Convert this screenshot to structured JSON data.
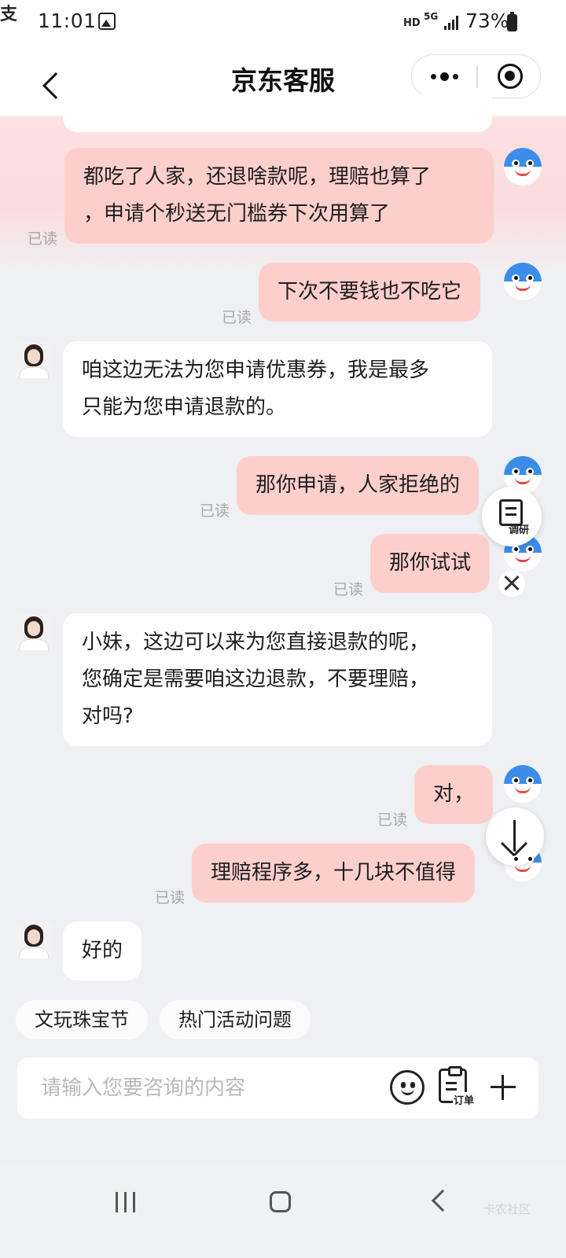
{
  "status_bar": {
    "time": "11:01",
    "network_hd": "HD",
    "network_gen": "5G",
    "battery": "73%"
  },
  "header": {
    "title": "京东客服"
  },
  "messages": [
    {
      "role": "user",
      "text": "都吃了人家，还退啥款呢，理赔也算了\n，申请个秒送无门槛券下次用算了",
      "status": "已读"
    },
    {
      "role": "user",
      "text": "下次不要钱也不吃它",
      "status": "已读"
    },
    {
      "role": "agent",
      "text": "咱这边无法为您申请优惠券，我是最多\n只能为您申请退款的。"
    },
    {
      "role": "user",
      "text": "那你申请，人家拒绝的",
      "status": "已读"
    },
    {
      "role": "user",
      "text": "那你试试",
      "status": "已读"
    },
    {
      "role": "agent",
      "text": "小妹，这边可以来为您直接退款的呢，\n您确定是需要咱这边退款，不要理赔，\n对吗?"
    },
    {
      "role": "user",
      "text": "对，",
      "status": "已读"
    },
    {
      "role": "user",
      "text": "理赔程序多，十几块不值得",
      "status": "已读"
    },
    {
      "role": "agent",
      "text": "好的"
    }
  ],
  "floating": {
    "survey_label": "调研"
  },
  "quick_replies": [
    "文玩珠宝节",
    "热门活动问题"
  ],
  "composer": {
    "placeholder": "请输入您要咨询的内容",
    "order_label": "订单"
  },
  "watermark": "卡农社区",
  "colors": {
    "user_bubble": "#fdcfcc",
    "agent_bubble": "#ffffff",
    "background": "#eff0f3"
  }
}
